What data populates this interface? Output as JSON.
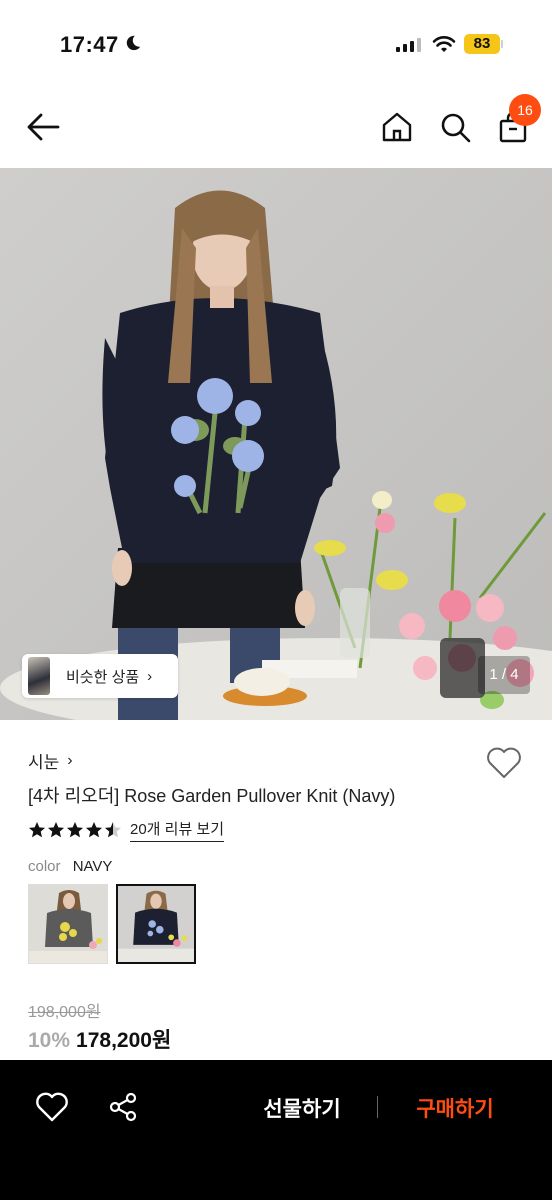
{
  "status_bar": {
    "time": "17:47",
    "battery": "83"
  },
  "nav": {
    "cart_count": "16"
  },
  "hero": {
    "similar_label": "비슷한 상품",
    "page_indicator": "1 / 4"
  },
  "product": {
    "brand": "시눈",
    "title": "[4차 리오더] Rose Garden Pullover Knit (Navy)",
    "rating": 4.5,
    "review_link": "20개 리뷰 보기",
    "color_label": "color",
    "color_value": "NAVY",
    "original_price": "198,000원",
    "discount": "10%",
    "price": "178,200원"
  },
  "bottom_bar": {
    "gift_label": "선물하기",
    "buy_label": "구매하기"
  },
  "colors": {
    "accent": "#ff4d12",
    "battery": "#f5c518"
  }
}
